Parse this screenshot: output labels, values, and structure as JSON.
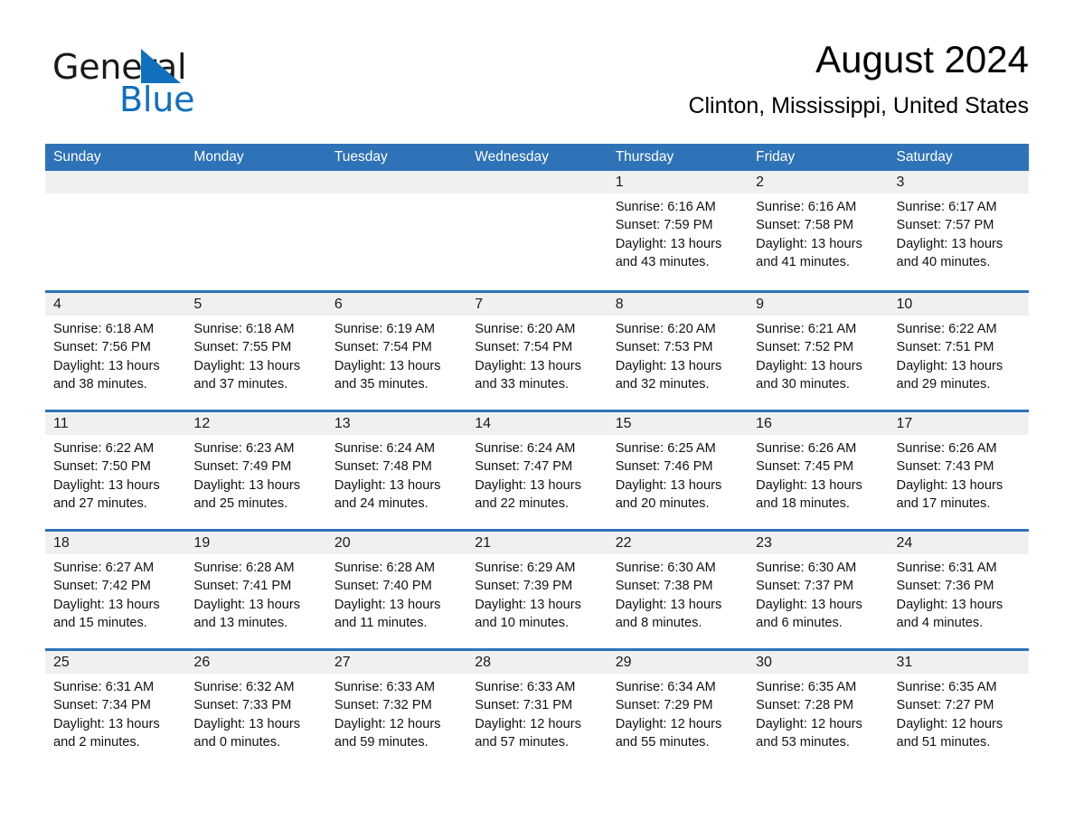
{
  "brand": {
    "name_part1": "General",
    "name_part2": "Blue",
    "accent_color": "#1070bd",
    "triangle_color": "#1070bd"
  },
  "header": {
    "title": "August 2024",
    "subtitle": "Clinton, Mississippi, United States"
  },
  "theme": {
    "header_blue": "#2e72b8",
    "daynum_band": "#f0f0f0",
    "text": "#121212"
  },
  "weekdays": [
    "Sunday",
    "Monday",
    "Tuesday",
    "Wednesday",
    "Thursday",
    "Friday",
    "Saturday"
  ],
  "weeks": [
    [
      {
        "day": "",
        "empty": true
      },
      {
        "day": "",
        "empty": true
      },
      {
        "day": "",
        "empty": true
      },
      {
        "day": "",
        "empty": true
      },
      {
        "day": "1",
        "sunrise": "Sunrise: 6:16 AM",
        "sunset": "Sunset: 7:59 PM",
        "daylight1": "Daylight: 13 hours",
        "daylight2": "and 43 minutes."
      },
      {
        "day": "2",
        "sunrise": "Sunrise: 6:16 AM",
        "sunset": "Sunset: 7:58 PM",
        "daylight1": "Daylight: 13 hours",
        "daylight2": "and 41 minutes."
      },
      {
        "day": "3",
        "sunrise": "Sunrise: 6:17 AM",
        "sunset": "Sunset: 7:57 PM",
        "daylight1": "Daylight: 13 hours",
        "daylight2": "and 40 minutes."
      }
    ],
    [
      {
        "day": "4",
        "sunrise": "Sunrise: 6:18 AM",
        "sunset": "Sunset: 7:56 PM",
        "daylight1": "Daylight: 13 hours",
        "daylight2": "and 38 minutes."
      },
      {
        "day": "5",
        "sunrise": "Sunrise: 6:18 AM",
        "sunset": "Sunset: 7:55 PM",
        "daylight1": "Daylight: 13 hours",
        "daylight2": "and 37 minutes."
      },
      {
        "day": "6",
        "sunrise": "Sunrise: 6:19 AM",
        "sunset": "Sunset: 7:54 PM",
        "daylight1": "Daylight: 13 hours",
        "daylight2": "and 35 minutes."
      },
      {
        "day": "7",
        "sunrise": "Sunrise: 6:20 AM",
        "sunset": "Sunset: 7:54 PM",
        "daylight1": "Daylight: 13 hours",
        "daylight2": "and 33 minutes."
      },
      {
        "day": "8",
        "sunrise": "Sunrise: 6:20 AM",
        "sunset": "Sunset: 7:53 PM",
        "daylight1": "Daylight: 13 hours",
        "daylight2": "and 32 minutes."
      },
      {
        "day": "9",
        "sunrise": "Sunrise: 6:21 AM",
        "sunset": "Sunset: 7:52 PM",
        "daylight1": "Daylight: 13 hours",
        "daylight2": "and 30 minutes."
      },
      {
        "day": "10",
        "sunrise": "Sunrise: 6:22 AM",
        "sunset": "Sunset: 7:51 PM",
        "daylight1": "Daylight: 13 hours",
        "daylight2": "and 29 minutes."
      }
    ],
    [
      {
        "day": "11",
        "sunrise": "Sunrise: 6:22 AM",
        "sunset": "Sunset: 7:50 PM",
        "daylight1": "Daylight: 13 hours",
        "daylight2": "and 27 minutes."
      },
      {
        "day": "12",
        "sunrise": "Sunrise: 6:23 AM",
        "sunset": "Sunset: 7:49 PM",
        "daylight1": "Daylight: 13 hours",
        "daylight2": "and 25 minutes."
      },
      {
        "day": "13",
        "sunrise": "Sunrise: 6:24 AM",
        "sunset": "Sunset: 7:48 PM",
        "daylight1": "Daylight: 13 hours",
        "daylight2": "and 24 minutes."
      },
      {
        "day": "14",
        "sunrise": "Sunrise: 6:24 AM",
        "sunset": "Sunset: 7:47 PM",
        "daylight1": "Daylight: 13 hours",
        "daylight2": "and 22 minutes."
      },
      {
        "day": "15",
        "sunrise": "Sunrise: 6:25 AM",
        "sunset": "Sunset: 7:46 PM",
        "daylight1": "Daylight: 13 hours",
        "daylight2": "and 20 minutes."
      },
      {
        "day": "16",
        "sunrise": "Sunrise: 6:26 AM",
        "sunset": "Sunset: 7:45 PM",
        "daylight1": "Daylight: 13 hours",
        "daylight2": "and 18 minutes."
      },
      {
        "day": "17",
        "sunrise": "Sunrise: 6:26 AM",
        "sunset": "Sunset: 7:43 PM",
        "daylight1": "Daylight: 13 hours",
        "daylight2": "and 17 minutes."
      }
    ],
    [
      {
        "day": "18",
        "sunrise": "Sunrise: 6:27 AM",
        "sunset": "Sunset: 7:42 PM",
        "daylight1": "Daylight: 13 hours",
        "daylight2": "and 15 minutes."
      },
      {
        "day": "19",
        "sunrise": "Sunrise: 6:28 AM",
        "sunset": "Sunset: 7:41 PM",
        "daylight1": "Daylight: 13 hours",
        "daylight2": "and 13 minutes."
      },
      {
        "day": "20",
        "sunrise": "Sunrise: 6:28 AM",
        "sunset": "Sunset: 7:40 PM",
        "daylight1": "Daylight: 13 hours",
        "daylight2": "and 11 minutes."
      },
      {
        "day": "21",
        "sunrise": "Sunrise: 6:29 AM",
        "sunset": "Sunset: 7:39 PM",
        "daylight1": "Daylight: 13 hours",
        "daylight2": "and 10 minutes."
      },
      {
        "day": "22",
        "sunrise": "Sunrise: 6:30 AM",
        "sunset": "Sunset: 7:38 PM",
        "daylight1": "Daylight: 13 hours",
        "daylight2": "and 8 minutes."
      },
      {
        "day": "23",
        "sunrise": "Sunrise: 6:30 AM",
        "sunset": "Sunset: 7:37 PM",
        "daylight1": "Daylight: 13 hours",
        "daylight2": "and 6 minutes."
      },
      {
        "day": "24",
        "sunrise": "Sunrise: 6:31 AM",
        "sunset": "Sunset: 7:36 PM",
        "daylight1": "Daylight: 13 hours",
        "daylight2": "and 4 minutes."
      }
    ],
    [
      {
        "day": "25",
        "sunrise": "Sunrise: 6:31 AM",
        "sunset": "Sunset: 7:34 PM",
        "daylight1": "Daylight: 13 hours",
        "daylight2": "and 2 minutes."
      },
      {
        "day": "26",
        "sunrise": "Sunrise: 6:32 AM",
        "sunset": "Sunset: 7:33 PM",
        "daylight1": "Daylight: 13 hours",
        "daylight2": "and 0 minutes."
      },
      {
        "day": "27",
        "sunrise": "Sunrise: 6:33 AM",
        "sunset": "Sunset: 7:32 PM",
        "daylight1": "Daylight: 12 hours",
        "daylight2": "and 59 minutes."
      },
      {
        "day": "28",
        "sunrise": "Sunrise: 6:33 AM",
        "sunset": "Sunset: 7:31 PM",
        "daylight1": "Daylight: 12 hours",
        "daylight2": "and 57 minutes."
      },
      {
        "day": "29",
        "sunrise": "Sunrise: 6:34 AM",
        "sunset": "Sunset: 7:29 PM",
        "daylight1": "Daylight: 12 hours",
        "daylight2": "and 55 minutes."
      },
      {
        "day": "30",
        "sunrise": "Sunrise: 6:35 AM",
        "sunset": "Sunset: 7:28 PM",
        "daylight1": "Daylight: 12 hours",
        "daylight2": "and 53 minutes."
      },
      {
        "day": "31",
        "sunrise": "Sunrise: 6:35 AM",
        "sunset": "Sunset: 7:27 PM",
        "daylight1": "Daylight: 12 hours",
        "daylight2": "and 51 minutes."
      }
    ]
  ]
}
